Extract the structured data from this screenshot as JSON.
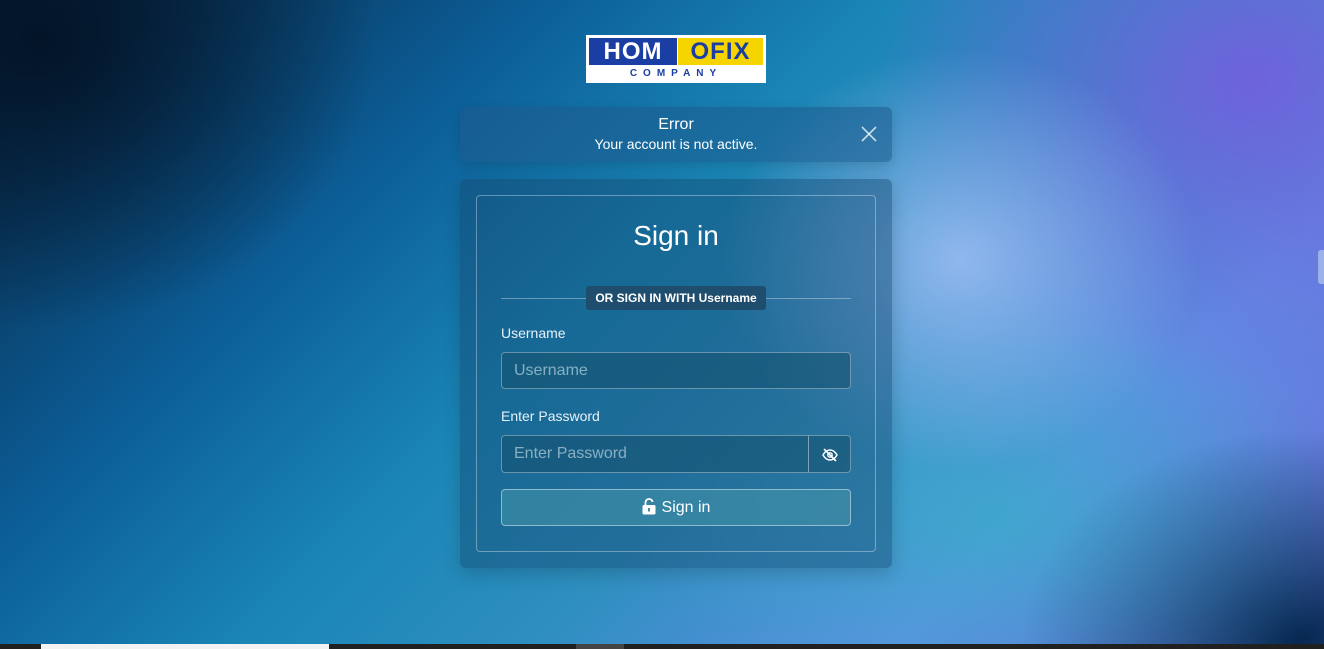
{
  "logo": {
    "part1": "HOM",
    "part2": "OFIX",
    "sub": "COMPANY"
  },
  "alert": {
    "title": "Error",
    "message": "Your account is not active.",
    "close_icon": "close-icon"
  },
  "form": {
    "heading": "Sign in",
    "divider_label": "OR SIGN IN WITH Username",
    "username_label": "Username",
    "username_placeholder": "Username",
    "password_label": "Enter Password",
    "password_placeholder": "Enter Password",
    "toggle_icon": "eye-slash-icon",
    "submit_label": "Sign in",
    "submit_icon": "unlock-icon"
  },
  "colors": {
    "logo_blue": "#1a3ea3",
    "logo_yellow": "#f5d400"
  }
}
